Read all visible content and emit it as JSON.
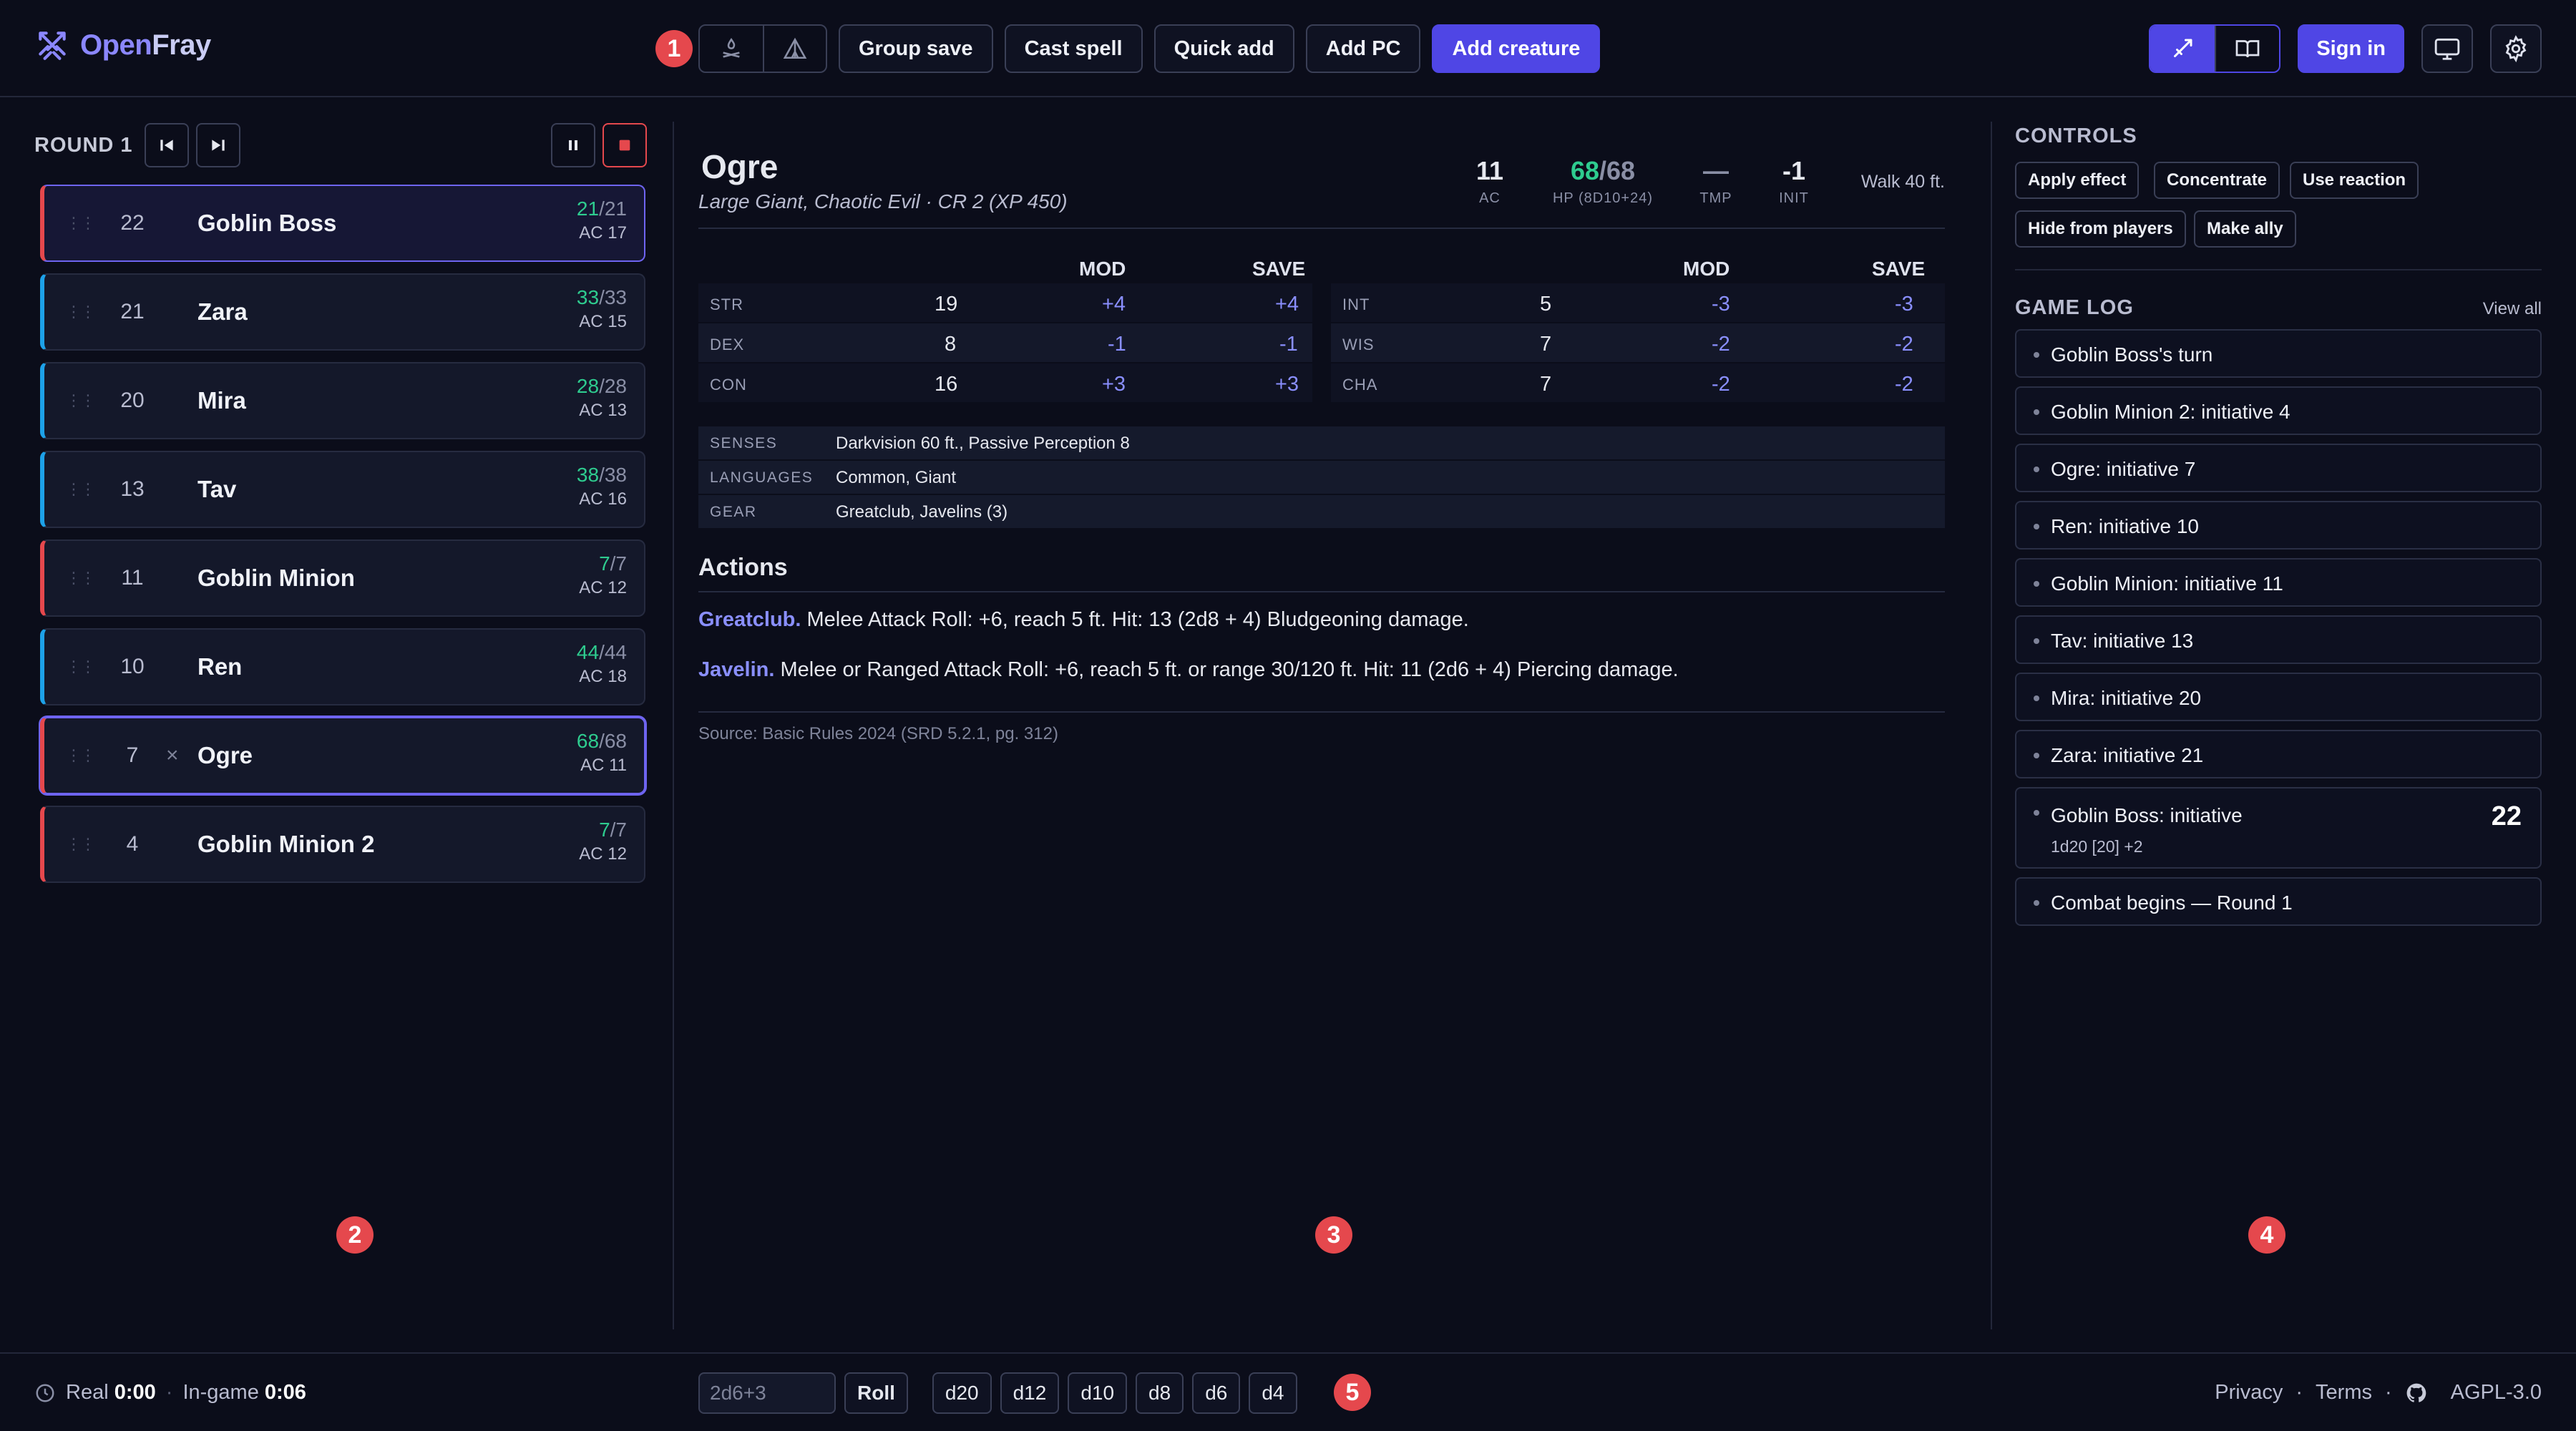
{
  "app": {
    "logo_open": "Open",
    "logo_fray": "Fray"
  },
  "toolbar": {
    "buttons": [
      "Group save",
      "Cast spell",
      "Quick add",
      "Add PC",
      "Add creature"
    ],
    "mode_icons": [
      "campfire-icon",
      "tent-icon"
    ]
  },
  "topright": {
    "sign_in": "Sign in"
  },
  "markers": [
    "1",
    "2",
    "3",
    "4",
    "5"
  ],
  "tracker": {
    "round_label": "ROUND 1",
    "combatants": [
      {
        "init": "22",
        "name": "Goblin Boss",
        "hp": "21",
        "max": "/21",
        "ac": "AC 17",
        "type": "monster",
        "state": "current"
      },
      {
        "init": "21",
        "name": "Zara",
        "hp": "33",
        "max": "/33",
        "ac": "AC 15",
        "type": "pc",
        "state": ""
      },
      {
        "init": "20",
        "name": "Mira",
        "hp": "28",
        "max": "/28",
        "ac": "AC 13",
        "type": "pc",
        "state": ""
      },
      {
        "init": "13",
        "name": "Tav",
        "hp": "38",
        "max": "/38",
        "ac": "AC 16",
        "type": "pc",
        "state": ""
      },
      {
        "init": "11",
        "name": "Goblin Minion",
        "hp": "7",
        "max": "/7",
        "ac": "AC 12",
        "type": "monster",
        "state": ""
      },
      {
        "init": "10",
        "name": "Ren",
        "hp": "44",
        "max": "/44",
        "ac": "AC 18",
        "type": "pc",
        "state": ""
      },
      {
        "init": "7",
        "name": "Ogre",
        "hp": "68",
        "max": "/68",
        "ac": "AC 11",
        "type": "monster",
        "state": "selected"
      },
      {
        "init": "4",
        "name": "Goblin Minion 2",
        "hp": "7",
        "max": "/7",
        "ac": "AC 12",
        "type": "monster",
        "state": ""
      }
    ],
    "remove_glyph": "×"
  },
  "monster": {
    "name": "Ogre",
    "subtitle": "Large Giant, Chaotic Evil · CR 2 (XP 450)",
    "ac": "11",
    "ac_label": "AC",
    "hp_cur": "68",
    "hp_max": "/68",
    "hp_label": "HP (8D10+24)",
    "tmp": "—",
    "tmp_label": "TMP",
    "init": "-1",
    "init_label": "INIT",
    "speed": "Walk 40 ft.",
    "col_mod": "MOD",
    "col_save": "SAVE",
    "abilities_left": [
      {
        "name": "STR",
        "score": "19",
        "mod": "+4",
        "save": "+4"
      },
      {
        "name": "DEX",
        "score": "8",
        "mod": "-1",
        "save": "-1"
      },
      {
        "name": "CON",
        "score": "16",
        "mod": "+3",
        "save": "+3"
      }
    ],
    "abilities_right": [
      {
        "name": "INT",
        "score": "5",
        "mod": "-3",
        "save": "-3"
      },
      {
        "name": "WIS",
        "score": "7",
        "mod": "-2",
        "save": "-2"
      },
      {
        "name": "CHA",
        "score": "7",
        "mod": "-2",
        "save": "-2"
      }
    ],
    "info": [
      {
        "key": "SENSES",
        "value": "Darkvision 60 ft., Passive Perception 8"
      },
      {
        "key": "LANGUAGES",
        "value": "Common, Giant"
      },
      {
        "key": "GEAR",
        "value": "Greatclub, Javelins (3)"
      }
    ],
    "actions_title": "Actions",
    "actions": [
      {
        "name": "Greatclub.",
        "text": " Melee Attack Roll: +6, reach 5 ft. Hit: 13 (2d8 + 4) Bludgeoning damage."
      },
      {
        "name": "Javelin.",
        "text": " Melee or Ranged Attack Roll: +6, reach 5 ft. or range 30/120 ft. Hit: 11 (2d6 + 4) Piercing damage."
      }
    ],
    "source": "Source: Basic Rules 2024 (SRD 5.2.1, pg. 312)"
  },
  "controls": {
    "title": "CONTROLS",
    "chips": [
      "Apply effect",
      "Concentrate",
      "Use reaction",
      "Hide from players",
      "Make ally"
    ]
  },
  "gamelog": {
    "title": "GAME LOG",
    "view_all": "View all",
    "items": [
      "Goblin Boss's turn",
      "Goblin Minion 2: initiative 4",
      "Ogre: initiative 7",
      "Ren: initiative 10",
      "Goblin Minion: initiative 11",
      "Tav: initiative 13",
      "Mira: initiative 20",
      "Zara: initiative 21"
    ],
    "roll_item": {
      "text": "Goblin Boss: initiative",
      "detail": "1d20 [20] +2",
      "total": "22"
    },
    "last_item": "Combat begins — Round 1"
  },
  "footer": {
    "real_label": "Real",
    "real_time": "0:00",
    "sep": "·",
    "ingame_label": "In-game",
    "ingame_time": "0:06",
    "dice_placeholder": "2d6+3",
    "roll": "Roll",
    "dice": [
      "d20",
      "d12",
      "d10",
      "d8",
      "d6",
      "d4"
    ],
    "privacy": "Privacy",
    "terms": "Terms",
    "license": "AGPL-3.0"
  }
}
